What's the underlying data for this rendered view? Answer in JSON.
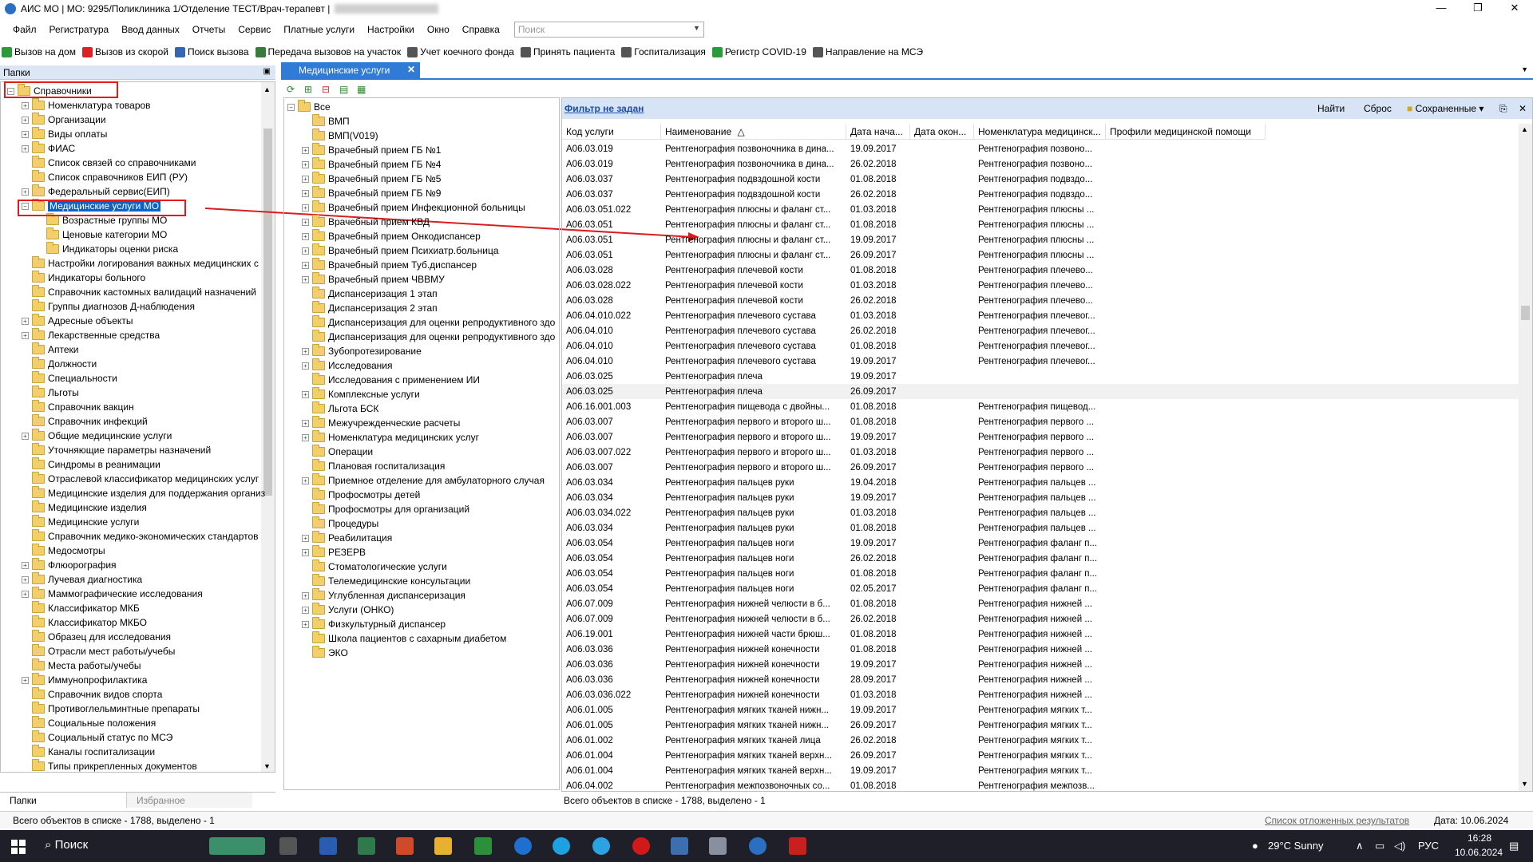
{
  "window": {
    "title": "АИС МО | МО: 9295/Поликлиника 1/Отделение ТЕСТ/Врач-терапевт |",
    "minimize": "—",
    "maximize": "❐",
    "close": "✕"
  },
  "menu": {
    "items": [
      "Файл",
      "Регистратура",
      "Ввод данных",
      "Отчеты",
      "Сервис",
      "Платные услуги",
      "Настройки",
      "Окно",
      "Справка"
    ],
    "search_placeholder": "Поиск"
  },
  "toolbar": {
    "items": [
      {
        "label": "Вызов на дом",
        "color": "#2a9a3a"
      },
      {
        "label": "Вызов из скорой",
        "color": "#d22"
      },
      {
        "label": "Поиск вызова",
        "color": "#3566b0"
      },
      {
        "label": "Передача вызовов на участок",
        "color": "#3a7a3a"
      },
      {
        "label": "Учет коечного фонда",
        "color": "#555"
      },
      {
        "label": "Принять пациента",
        "color": "#555"
      },
      {
        "label": "Госпитализация",
        "color": "#555"
      },
      {
        "label": "Регистр COVID-19",
        "color": "#2a9a3a"
      },
      {
        "label": "Направление на МСЭ",
        "color": "#555"
      }
    ]
  },
  "left_panel": {
    "title": "Папки",
    "root": "Справочники",
    "items": [
      {
        "label": "Номенклатура товаров",
        "level": 1,
        "expand": true
      },
      {
        "label": "Организации",
        "level": 1,
        "expand": true
      },
      {
        "label": "Виды оплаты",
        "level": 1,
        "expand": true
      },
      {
        "label": "ФИАС",
        "level": 1,
        "expand": true
      },
      {
        "label": "Список связей со справочниками",
        "level": 1,
        "expand": false
      },
      {
        "label": "Список справочников ЕИП (РУ)",
        "level": 1,
        "expand": false
      },
      {
        "label": "Федеральный сервис(ЕИП)",
        "level": 1,
        "expand": true
      },
      {
        "label": "Медицинские услуги МО",
        "level": 1,
        "expand": true,
        "selected": true
      },
      {
        "label": "Возрастные группы МО",
        "level": 2,
        "expand": false
      },
      {
        "label": "Ценовые категории МО",
        "level": 2,
        "expand": false
      },
      {
        "label": "Индикаторы оценки риска",
        "level": 2,
        "expand": false
      },
      {
        "label": "Настройки логирования важных медицинских с",
        "level": 1,
        "expand": false
      },
      {
        "label": "Индикаторы больного",
        "level": 1,
        "expand": false
      },
      {
        "label": "Справочник кастомных валидаций назначений",
        "level": 1,
        "expand": false
      },
      {
        "label": "Группы диагнозов Д-наблюдения",
        "level": 1,
        "expand": false
      },
      {
        "label": "Адресные объекты",
        "level": 1,
        "expand": true
      },
      {
        "label": "Лекарственные средства",
        "level": 1,
        "expand": true
      },
      {
        "label": "Аптеки",
        "level": 1,
        "expand": false
      },
      {
        "label": "Должности",
        "level": 1,
        "expand": false
      },
      {
        "label": "Специальности",
        "level": 1,
        "expand": false
      },
      {
        "label": "Льготы",
        "level": 1,
        "expand": false
      },
      {
        "label": "Справочник вакцин",
        "level": 1,
        "expand": false
      },
      {
        "label": "Справочник инфекций",
        "level": 1,
        "expand": false
      },
      {
        "label": "Общие медицинские услуги",
        "level": 1,
        "expand": true
      },
      {
        "label": "Уточняющие параметры назначений",
        "level": 1,
        "expand": false
      },
      {
        "label": "Синдромы в реанимации",
        "level": 1,
        "expand": false
      },
      {
        "label": "Отраслевой классификатор медицинских услуг",
        "level": 1,
        "expand": false
      },
      {
        "label": "Медицинские изделия для поддержания организ",
        "level": 1,
        "expand": false
      },
      {
        "label": "Медицинские изделия",
        "level": 1,
        "expand": false
      },
      {
        "label": "Медицинские услуги",
        "level": 1,
        "expand": false
      },
      {
        "label": "Справочник медико-экономических стандартов",
        "level": 1,
        "expand": false
      },
      {
        "label": "Медосмотры",
        "level": 1,
        "expand": false
      },
      {
        "label": "Флюорография",
        "level": 1,
        "expand": true
      },
      {
        "label": "Лучевая диагностика",
        "level": 1,
        "expand": true
      },
      {
        "label": "Маммографические исследования",
        "level": 1,
        "expand": true
      },
      {
        "label": "Классификатор МКБ",
        "level": 1,
        "expand": false
      },
      {
        "label": "Классификатор МКБО",
        "level": 1,
        "expand": false
      },
      {
        "label": "Образец для исследования",
        "level": 1,
        "expand": false
      },
      {
        "label": "Отрасли мест работы/учебы",
        "level": 1,
        "expand": false
      },
      {
        "label": "Места работы/учебы",
        "level": 1,
        "expand": false
      },
      {
        "label": "Иммунопрофилактика",
        "level": 1,
        "expand": true
      },
      {
        "label": "Справочник видов спорта",
        "level": 1,
        "expand": false
      },
      {
        "label": "Противоглельминтные препараты",
        "level": 1,
        "expand": false
      },
      {
        "label": "Социальные положения",
        "level": 1,
        "expand": false
      },
      {
        "label": "Социальный статус по МСЭ",
        "level": 1,
        "expand": false
      },
      {
        "label": "Каналы госпитализации",
        "level": 1,
        "expand": false
      },
      {
        "label": "Типы прикрепленных документов",
        "level": 1,
        "expand": false
      }
    ],
    "tab_folders": "Папки",
    "tab_favorites": "Избранное"
  },
  "doc_tab": {
    "label": "Медицинские услуги",
    "close": "✕"
  },
  "mid_tree": {
    "root": "Все",
    "items": [
      {
        "label": "ВМП",
        "expand": false
      },
      {
        "label": "ВМП(V019)",
        "expand": false
      },
      {
        "label": "Врачебный прием ГБ №1",
        "expand": true
      },
      {
        "label": "Врачебный прием ГБ №4",
        "expand": true
      },
      {
        "label": "Врачебный прием ГБ №5",
        "expand": true
      },
      {
        "label": "Врачебный прием ГБ №9",
        "expand": true
      },
      {
        "label": "Врачебный прием Инфекционной больницы",
        "expand": true
      },
      {
        "label": "Врачебный прием КВД",
        "expand": true
      },
      {
        "label": "Врачебный прием Онкодиспансер",
        "expand": true
      },
      {
        "label": "Врачебный прием Психиатр.больница",
        "expand": true
      },
      {
        "label": "Врачебный прием Туб.диспансер",
        "expand": true
      },
      {
        "label": "Врачебный прием ЧВВМУ",
        "expand": true
      },
      {
        "label": "Диспансеризация 1 этап",
        "expand": false
      },
      {
        "label": "Диспансеризация 2 этап",
        "expand": false
      },
      {
        "label": "Диспансеризация для оценки репродуктивного здо",
        "expand": false
      },
      {
        "label": "Диспансеризация для оценки репродуктивного здо",
        "expand": false
      },
      {
        "label": "Зубопротезирование",
        "expand": true
      },
      {
        "label": "Исследования",
        "expand": true
      },
      {
        "label": "Исследования с применением ИИ",
        "expand": false
      },
      {
        "label": "Комплексные услуги",
        "expand": true
      },
      {
        "label": "Льгота БСК",
        "expand": false
      },
      {
        "label": "Межучрежденческие расчеты",
        "expand": true
      },
      {
        "label": "Номенклатура медицинских услуг",
        "expand": true
      },
      {
        "label": "Операции",
        "expand": false
      },
      {
        "label": "Плановая госпитализация",
        "expand": false
      },
      {
        "label": "Приемное отделение для амбулаторного случая",
        "expand": true
      },
      {
        "label": "Профосмотры детей",
        "expand": false
      },
      {
        "label": "Профосмотры для организаций",
        "expand": false
      },
      {
        "label": "Процедуры",
        "expand": false
      },
      {
        "label": "Реабилитация",
        "expand": true
      },
      {
        "label": "РЕЗЕРВ",
        "expand": true
      },
      {
        "label": "Стоматологические услуги",
        "expand": false
      },
      {
        "label": "Телемедицинские консультации",
        "expand": false
      },
      {
        "label": "Углубленная диспансеризация",
        "expand": true
      },
      {
        "label": "Услуги (ОНКО)",
        "expand": true
      },
      {
        "label": "Физкультурный диспансер",
        "expand": true
      },
      {
        "label": "Школа пациентов с сахарным диабетом",
        "expand": false
      },
      {
        "label": "ЭКО",
        "expand": false
      }
    ]
  },
  "grid": {
    "filter_link": "Фильтр не задан",
    "find": "Найти",
    "reset": "Сброс",
    "saved": "Сохраненные",
    "columns": [
      "Код услуги",
      "Наименование",
      "Дата нача...",
      "Дата окон...",
      "Номенклатура медицинск...",
      "Профили медицинской помощи"
    ],
    "rows": [
      [
        "A06.03.019",
        "Рентгенография позвоночника в дина...",
        "19.09.2017",
        "",
        "Рентгенография позвоно..."
      ],
      [
        "A06.03.019",
        "Рентгенография позвоночника в дина...",
        "26.02.2018",
        "",
        "Рентгенография позвоно..."
      ],
      [
        "A06.03.037",
        "Рентгенография подвздошной кости",
        "01.08.2018",
        "",
        "Рентгенография подвздо..."
      ],
      [
        "A06.03.037",
        "Рентгенография подвздошной кости",
        "26.02.2018",
        "",
        "Рентгенография подвздо..."
      ],
      [
        "A06.03.051.022",
        "Рентгенография плюсны и фаланг ст...",
        "01.03.2018",
        "",
        "Рентгенография плюсны ..."
      ],
      [
        "A06.03.051",
        "Рентгенография плюсны и фаланг ст...",
        "01.08.2018",
        "",
        "Рентгенография плюсны ..."
      ],
      [
        "A06.03.051",
        "Рентгенография плюсны и фаланг ст...",
        "19.09.2017",
        "",
        "Рентгенография плюсны ..."
      ],
      [
        "A06.03.051",
        "Рентгенография плюсны и фаланг ст...",
        "26.09.2017",
        "",
        "Рентгенография плюсны ..."
      ],
      [
        "A06.03.028",
        "Рентгенография плечевой кости",
        "01.08.2018",
        "",
        "Рентгенография плечево..."
      ],
      [
        "A06.03.028.022",
        "Рентгенография плечевой кости",
        "01.03.2018",
        "",
        "Рентгенография плечево..."
      ],
      [
        "A06.03.028",
        "Рентгенография плечевой кости",
        "26.02.2018",
        "",
        "Рентгенография плечево..."
      ],
      [
        "A06.04.010.022",
        "Рентгенография плечевого сустава",
        "01.03.2018",
        "",
        "Рентгенография плечевог..."
      ],
      [
        "A06.04.010",
        "Рентгенография плечевого сустава",
        "26.02.2018",
        "",
        "Рентгенография плечевог..."
      ],
      [
        "A06.04.010",
        "Рентгенография плечевого сустава",
        "01.08.2018",
        "",
        "Рентгенография плечевог..."
      ],
      [
        "A06.04.010",
        "Рентгенография плечевого сустава",
        "19.09.2017",
        "",
        "Рентгенография плечевог..."
      ],
      [
        "A06.03.025",
        "Рентгенография плеча",
        "19.09.2017",
        "",
        ""
      ],
      [
        "A06.03.025",
        "Рентгенография плеча",
        "26.09.2017",
        "",
        ""
      ],
      [
        "A06.16.001.003",
        "Рентгенография пищевода с двойны...",
        "01.08.2018",
        "",
        "Рентгенография пищевод..."
      ],
      [
        "A06.03.007",
        "Рентгенография первого и второго ш...",
        "01.08.2018",
        "",
        "Рентгенография первого ..."
      ],
      [
        "A06.03.007",
        "Рентгенография первого и второго ш...",
        "19.09.2017",
        "",
        "Рентгенография первого ..."
      ],
      [
        "A06.03.007.022",
        "Рентгенография первого и второго ш...",
        "01.03.2018",
        "",
        "Рентгенография первого ..."
      ],
      [
        "A06.03.007",
        "Рентгенография первого и второго ш...",
        "26.09.2017",
        "",
        "Рентгенография первого ..."
      ],
      [
        "A06.03.034",
        "Рентгенография пальцев руки",
        "19.04.2018",
        "",
        "Рентгенография пальцев ..."
      ],
      [
        "A06.03.034",
        "Рентгенография пальцев руки",
        "19.09.2017",
        "",
        "Рентгенография пальцев ..."
      ],
      [
        "A06.03.034.022",
        "Рентгенография пальцев руки",
        "01.03.2018",
        "",
        "Рентгенография пальцев ..."
      ],
      [
        "A06.03.034",
        "Рентгенография пальцев руки",
        "01.08.2018",
        "",
        "Рентгенография пальцев ..."
      ],
      [
        "A06.03.054",
        "Рентгенография пальцев ноги",
        "19.09.2017",
        "",
        "Рентгенография фаланг п..."
      ],
      [
        "A06.03.054",
        "Рентгенография пальцев ноги",
        "26.02.2018",
        "",
        "Рентгенография фаланг п..."
      ],
      [
        "A06.03.054",
        "Рентгенография пальцев ноги",
        "01.08.2018",
        "",
        "Рентгенография фаланг п..."
      ],
      [
        "A06.03.054",
        "Рентгенография пальцев ноги",
        "02.05.2017",
        "",
        "Рентгенография фаланг п..."
      ],
      [
        "A06.07.009",
        "Рентгенография нижней челюсти в б...",
        "01.08.2018",
        "",
        "Рентгенография нижней ..."
      ],
      [
        "A06.07.009",
        "Рентгенография нижней челюсти в б...",
        "26.02.2018",
        "",
        "Рентгенография нижней ..."
      ],
      [
        "A06.19.001",
        "Рентгенография нижней части брюш...",
        "01.08.2018",
        "",
        "Рентгенография нижней ..."
      ],
      [
        "A06.03.036",
        "Рентгенография нижней конечности",
        "01.08.2018",
        "",
        "Рентгенография нижней ..."
      ],
      [
        "A06.03.036",
        "Рентгенография нижней конечности",
        "19.09.2017",
        "",
        "Рентгенография нижней ..."
      ],
      [
        "A06.03.036",
        "Рентгенография нижней конечности",
        "28.09.2017",
        "",
        "Рентгенография нижней ..."
      ],
      [
        "A06.03.036.022",
        "Рентгенография нижней конечности",
        "01.03.2018",
        "",
        "Рентгенография нижней ..."
      ],
      [
        "A06.01.005",
        "Рентгенография мягких тканей нижн...",
        "19.09.2017",
        "",
        "Рентгенография мягких т..."
      ],
      [
        "A06.01.005",
        "Рентгенография мягких тканей нижн...",
        "26.09.2017",
        "",
        "Рентгенография мягких т..."
      ],
      [
        "A06.01.002",
        "Рентгенография мягких тканей лица",
        "26.02.2018",
        "",
        "Рентгенография мягких т..."
      ],
      [
        "A06.01.004",
        "Рентгенография мягких тканей верхн...",
        "26.09.2017",
        "",
        "Рентгенография мягких т..."
      ],
      [
        "A06.01.004",
        "Рентгенография мягких тканей верхн...",
        "19.09.2017",
        "",
        "Рентгенография мягких т..."
      ],
      [
        "A06.04.002",
        "Рентгенография межпозвоночных со...",
        "01.08.2018",
        "",
        "Рентгенография межпозв..."
      ]
    ],
    "status": "Всего объектов в списке - 1788, выделено - 1"
  },
  "statusbar": {
    "left": "Всего объектов в списке - 1788, выделено - 1",
    "deferred": "Список отложенных результатов",
    "date": "Дата: 10.06.2024"
  },
  "taskbar": {
    "search": "Поиск",
    "weather": "29°C  Sunny",
    "lang": "РУС",
    "time": "16:28",
    "date": "10.06.2024"
  }
}
